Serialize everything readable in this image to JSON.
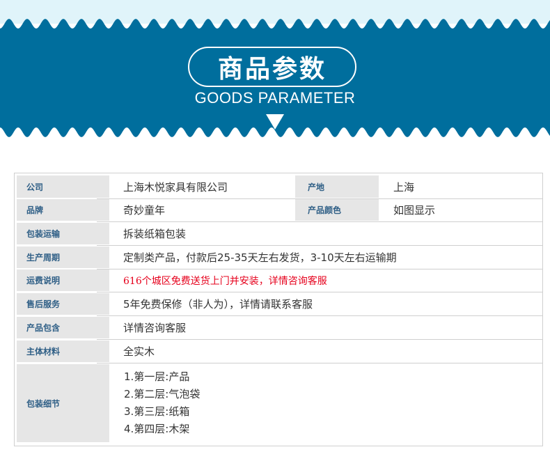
{
  "header": {
    "title": "商品参数",
    "subtitle": "GOODS PARAMETER",
    "colors": {
      "banner": "#006e9d",
      "wave_light": "#e0f4fa",
      "label_bg": "#e6e6e6",
      "label_text": "#2f5f86",
      "highlight": "#e6001c"
    }
  },
  "params": {
    "company_label": "公司",
    "company_value": "上海木悦家具有限公司",
    "origin_label": "产地",
    "origin_value": "上海",
    "brand_label": "品牌",
    "brand_value": "奇妙童年",
    "color_label": "产品颜色",
    "color_value": "如图显示",
    "shipping_label": "包装运输",
    "shipping_value": "拆装纸箱包装",
    "period_label": "生产周期",
    "period_value": "定制类产品，付款后25-35天左右发货，3-10天左右运输期",
    "freight_label": "运费说明",
    "freight_value": "616个城区免费送货上门并安装，详情咨询客服",
    "service_label": "售后服务",
    "service_value": "5年免费保修（非人为），详情请联系客服",
    "contents_label": "产品包含",
    "contents_value": "详情咨询客服",
    "material_label": "主体材料",
    "material_value": "全实木",
    "packing_label": "包装细节",
    "packing_items": [
      "1.第一层:产品",
      "2.第二层:气泡袋",
      "3.第三层:纸箱",
      "4.第四层:木架"
    ]
  }
}
